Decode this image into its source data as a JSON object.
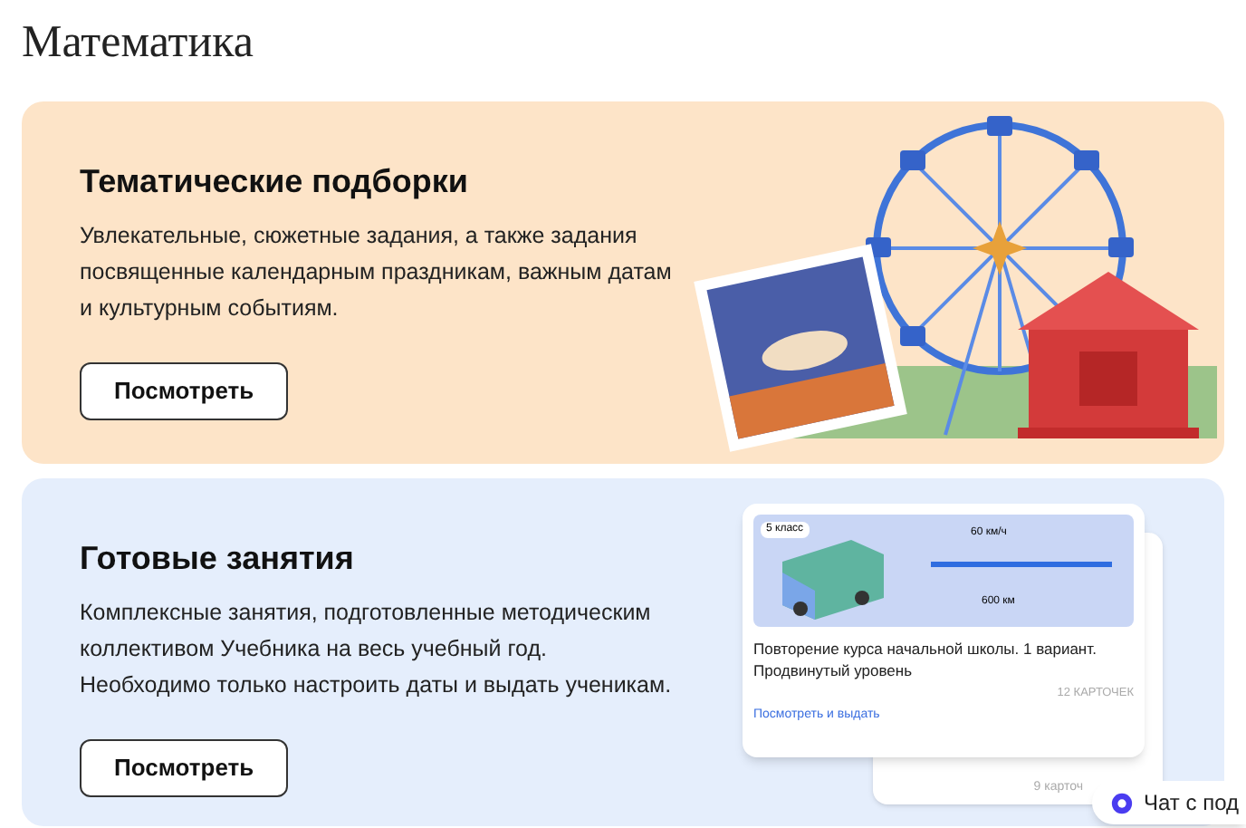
{
  "page_title": "Математика",
  "sections": [
    {
      "kind": "fair",
      "title": "Тематические подборки",
      "description": "Увлекательные, сюжетные задания, а также задания посвященные календарным праздникам, важным датам и культурным событиям.",
      "button": "Посмотреть"
    },
    {
      "kind": "lessons",
      "title": "Готовые занятия",
      "description": "Комплексные занятия, подготовленные методическим коллективом Учебника на весь учебный год. Необходимо только настроить даты и выдать ученикам.",
      "button": "Посмотреть",
      "preview_card": {
        "grade": "5 класс",
        "speed": "60 км/ч",
        "distance": "600 км",
        "title": "Повторение курса начальной школы. 1 вариант. Продвинутый уровень",
        "count": "12 КАРТОЧЕК",
        "link": "Посмотреть и выдать"
      },
      "back_card": {
        "count": "9 карточ"
      }
    }
  ],
  "chat_button": "Чат с под"
}
